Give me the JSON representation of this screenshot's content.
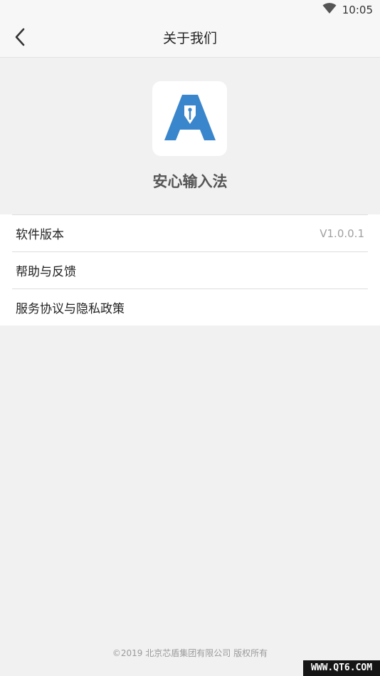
{
  "status_bar": {
    "time": "10:05",
    "icons": [
      "wifi-icon"
    ]
  },
  "header": {
    "back_icon": "back-arrow-icon",
    "title": "关于我们"
  },
  "app": {
    "icon": "app-logo-icon",
    "name": "安心输入法",
    "brand_color": "#3a86cc"
  },
  "menu": {
    "items": [
      {
        "label": "软件版本",
        "value": "V1.0.0.1"
      },
      {
        "label": "帮助与反馈"
      },
      {
        "label": "服务协议与隐私政策"
      }
    ]
  },
  "footer": {
    "copyright": "©2019 北京芯盾集团有限公司 版权所有"
  },
  "watermark": {
    "text": "WWW.QT6.COM"
  }
}
